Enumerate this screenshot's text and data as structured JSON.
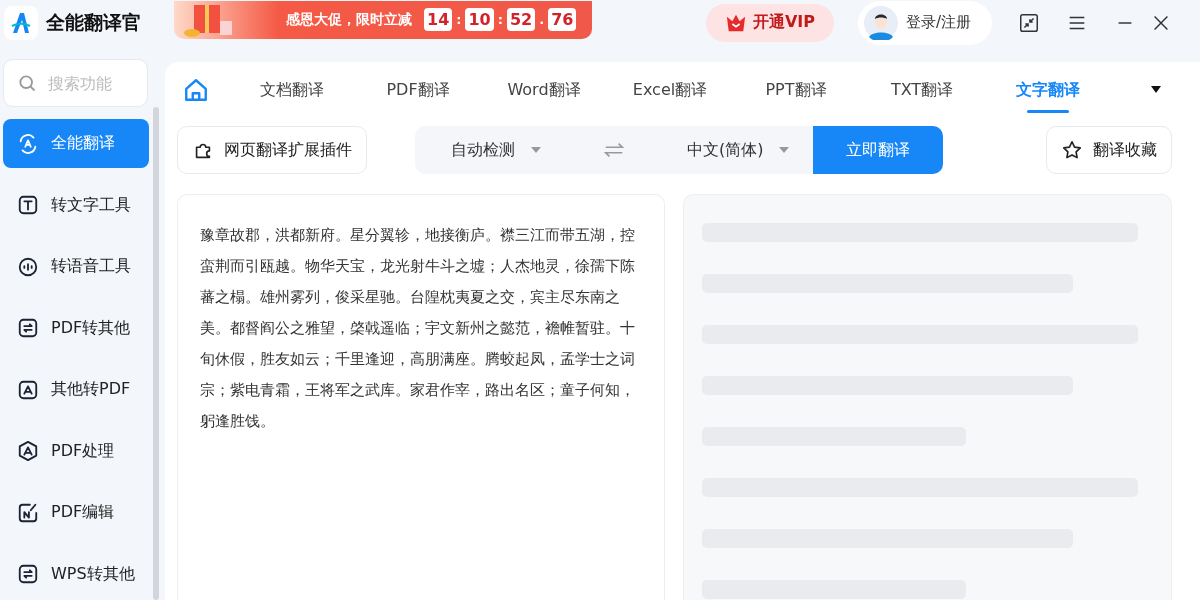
{
  "app": {
    "title": "全能翻译官"
  },
  "promo": {
    "text": "感恩大促，限时立减",
    "timer": [
      "14",
      "10",
      "52",
      "76"
    ],
    "separators": [
      ":",
      ":",
      "."
    ]
  },
  "header": {
    "vip_label": "开通VIP",
    "login_label": "登录/注册"
  },
  "sidebar": {
    "search": {
      "placeholder": "搜索功能"
    },
    "items": [
      {
        "label": "全能翻译",
        "selected": true
      },
      {
        "label": "转文字工具",
        "selected": false
      },
      {
        "label": "转语音工具",
        "selected": false
      },
      {
        "label": "PDF转其他",
        "selected": false
      },
      {
        "label": "其他转PDF",
        "selected": false
      },
      {
        "label": "PDF处理",
        "selected": false
      },
      {
        "label": "PDF编辑",
        "selected": false
      },
      {
        "label": "WPS转其他",
        "selected": false
      }
    ]
  },
  "tabs": [
    {
      "label": "文档翻译",
      "selected": false
    },
    {
      "label": "PDF翻译",
      "selected": false
    },
    {
      "label": "Word翻译",
      "selected": false
    },
    {
      "label": "Excel翻译",
      "selected": false
    },
    {
      "label": "PPT翻译",
      "selected": false
    },
    {
      "label": "TXT翻译",
      "selected": false
    },
    {
      "label": "文字翻译",
      "selected": true
    }
  ],
  "toolbar": {
    "plugin_label": "网页翻译扩展插件",
    "source_language": "自动检测",
    "target_language": "中文(简体)",
    "translate_label": "立即翻译",
    "favorites_label": "翻译收藏"
  },
  "source_text": "豫章故郡，洪都新府。星分翼轸，地接衡庐。襟三江而带五湖，控蛮荆而引瓯越。物华天宝，龙光射牛斗之墟；人杰地灵，徐孺下陈蕃之榻。雄州雾列，俊采星驰。台隍枕夷夏之交，宾主尽东南之美。都督阎公之雅望，棨戟遥临；宇文新州之懿范，襜帷暂驻。十旬休假，胜友如云；千里逢迎，高朋满座。腾蛟起凤，孟学士之词宗；紫电青霜，王将军之武库。家君作宰，路出名区；童子何知，躬逢胜饯。"
}
